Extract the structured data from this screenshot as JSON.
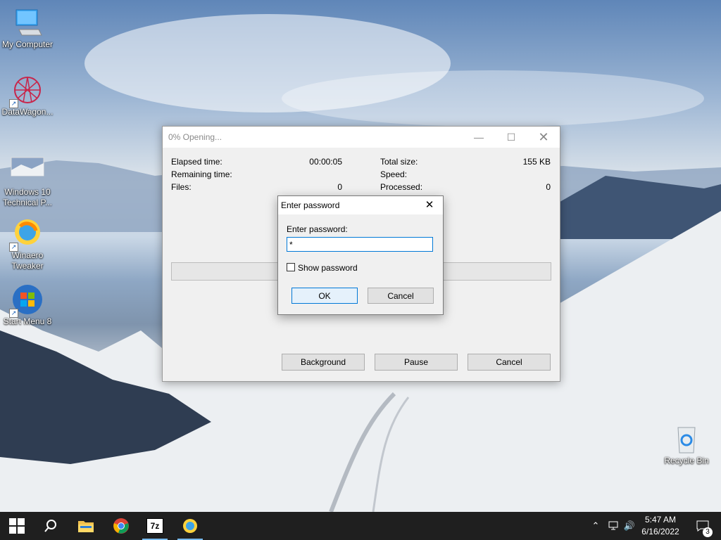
{
  "desktop": {
    "icons": [
      {
        "label": "My Computer",
        "icon": "monitor-icon"
      },
      {
        "label": "DataWagon...",
        "icon": "datawagon-icon"
      },
      {
        "label": "Windows 10 Technical P...",
        "icon": "image-thumbnail-icon"
      },
      {
        "label": "Winaero Tweaker",
        "icon": "winaero-icon"
      },
      {
        "label": "Start Menu 8",
        "icon": "start-menu-8-icon"
      },
      {
        "label": "Recycle Bin",
        "icon": "recycle-bin-icon"
      }
    ]
  },
  "progress_window": {
    "title": "0% Opening...",
    "progress_fraction": 0,
    "stats_left": [
      {
        "label": "Elapsed time:",
        "value": "00:00:05"
      },
      {
        "label": "Remaining time:",
        "value": ""
      },
      {
        "label": "Files:",
        "value": "0"
      }
    ],
    "stats_right": [
      {
        "label": "Total size:",
        "value": "155 KB"
      },
      {
        "label": "Speed:",
        "value": ""
      },
      {
        "label": "Processed:",
        "value": "0"
      }
    ],
    "buttons": {
      "background": "Background",
      "pause": "Pause",
      "cancel": "Cancel"
    }
  },
  "password_dialog": {
    "title": "Enter password",
    "field_label": "Enter password:",
    "field_value": "*",
    "show_password_label": "Show password",
    "show_password_checked": false,
    "ok_label": "OK",
    "cancel_label": "Cancel"
  },
  "taskbar": {
    "apps": [
      "start-icon",
      "search-icon",
      "file-explorer-icon",
      "chrome-icon",
      "7zip-icon",
      "winaero-icon"
    ],
    "active_apps": [
      "7zip-icon",
      "winaero-icon"
    ],
    "clock_time": "5:47 AM",
    "clock_date": "6/16/2022",
    "notification_count": "3"
  }
}
